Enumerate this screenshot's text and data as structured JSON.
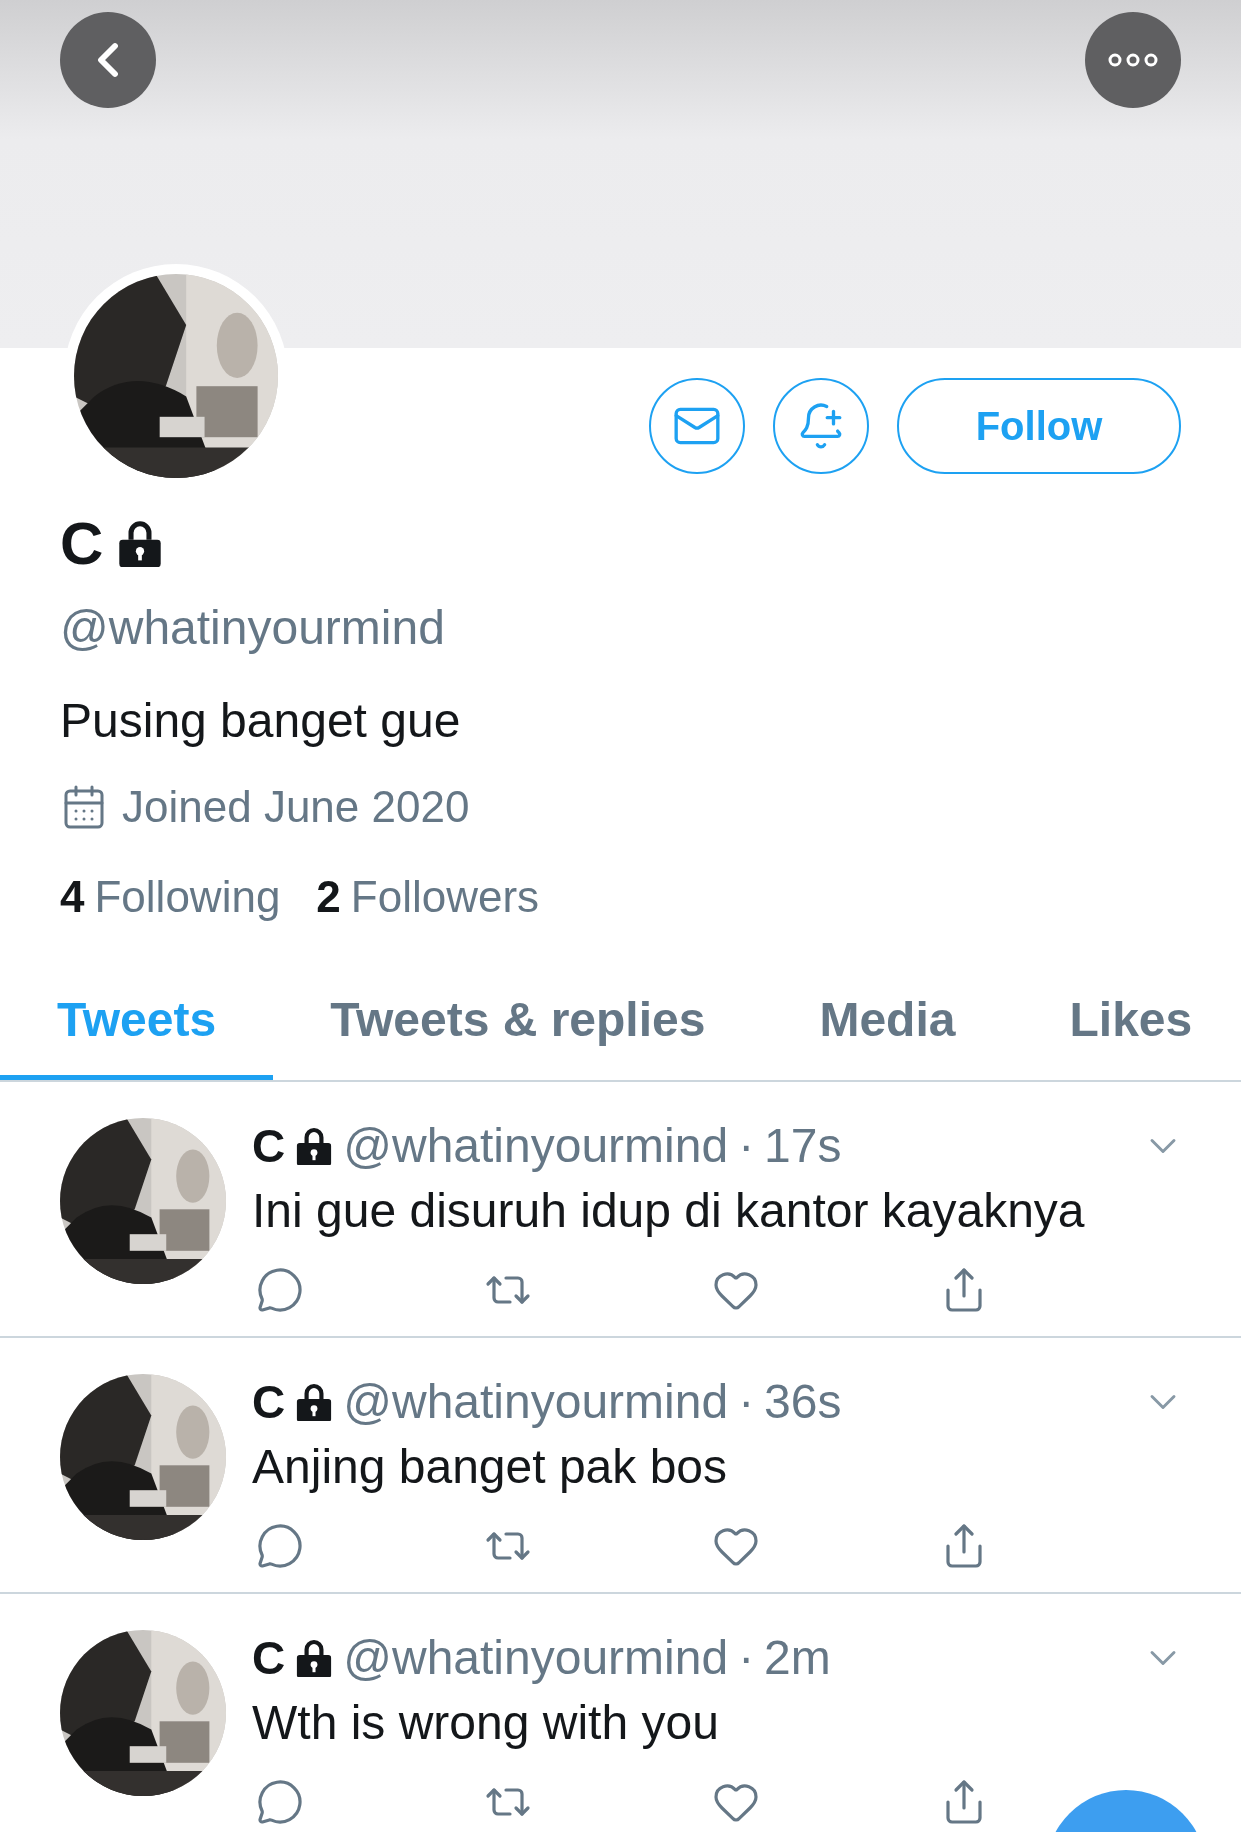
{
  "profile": {
    "name": "C",
    "protected": true,
    "handle": "@whatinyourmind",
    "bio": "Pusing banget gue",
    "joined": "Joined June 2020",
    "following_count": "4",
    "following_label": "Following",
    "followers_count": "2",
    "followers_label": "Followers"
  },
  "follow_button": "Follow",
  "tabs": [
    {
      "label": "Tweets",
      "selected": true
    },
    {
      "label": "Tweets & replies",
      "selected": false
    },
    {
      "label": "Media",
      "selected": false
    },
    {
      "label": "Likes",
      "selected": false
    }
  ],
  "tweets": [
    {
      "name": "C",
      "protected": true,
      "handle": "@whatinyourmind",
      "separator": "·",
      "time": "17s",
      "text": "Ini gue disuruh idup di kantor kayaknya"
    },
    {
      "name": "C",
      "protected": true,
      "handle": "@whatinyourmind",
      "separator": "·",
      "time": "36s",
      "text": "Anjing banget pak bos"
    },
    {
      "name": "C",
      "protected": true,
      "handle": "@whatinyourmind",
      "separator": "·",
      "time": "2m",
      "text": "Wth is wrong with you"
    }
  ]
}
